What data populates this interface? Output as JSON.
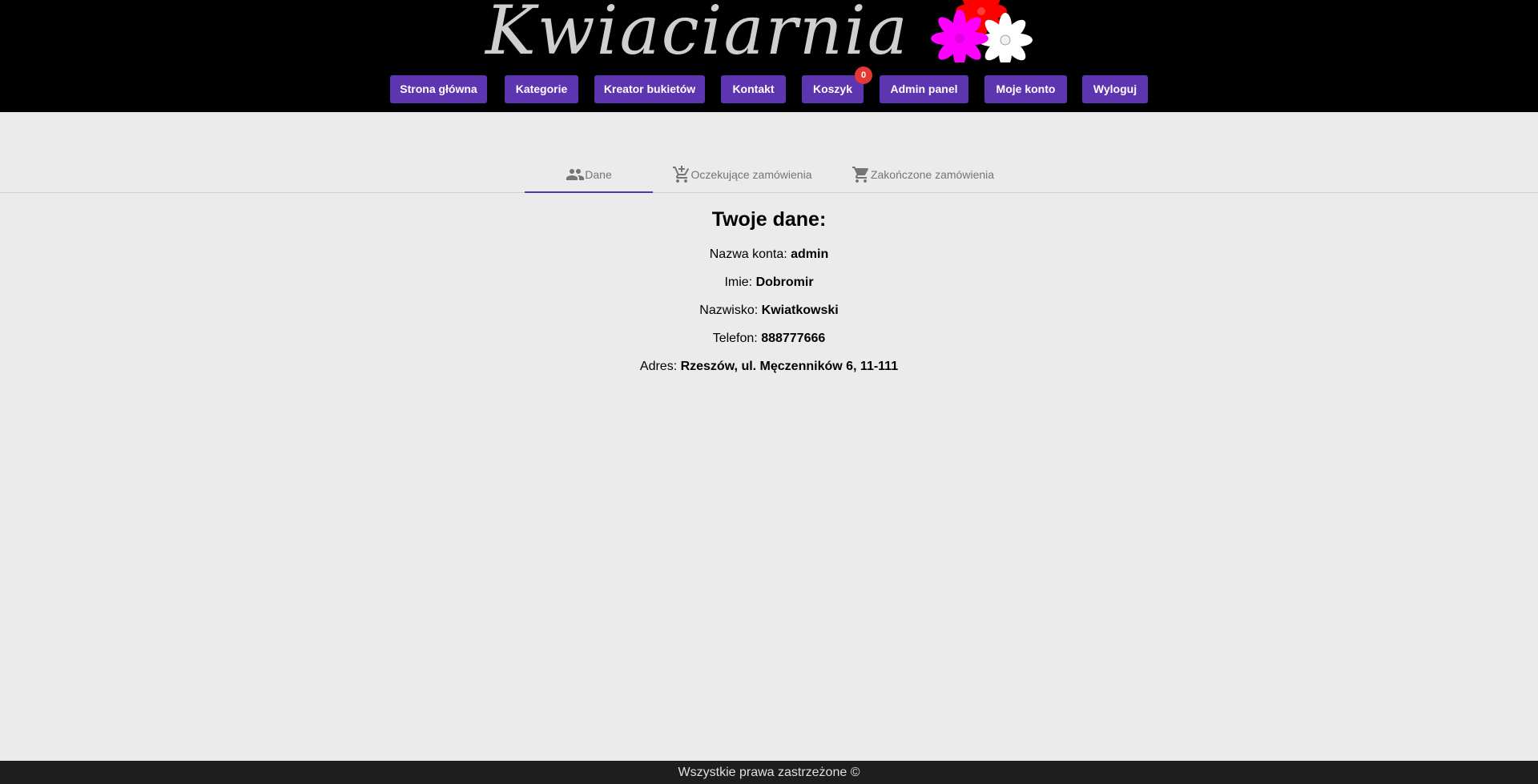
{
  "header": {
    "brand": "Kwiaciarnia",
    "colors": {
      "background": "#000000",
      "brand_text": "#cfcfcf",
      "nav_button": "#5e35b1",
      "badge": "#e53935"
    }
  },
  "nav": {
    "items": [
      {
        "label": "Strona główna"
      },
      {
        "label": "Kategorie"
      },
      {
        "label": "Kreator bukietów"
      },
      {
        "label": "Kontakt"
      },
      {
        "label": "Koszyk",
        "badge": "0"
      },
      {
        "label": "Admin panel"
      },
      {
        "label": "Moje konto"
      },
      {
        "label": "Wyloguj"
      }
    ]
  },
  "tabs": [
    {
      "label": "Dane",
      "icon": "people-icon",
      "active": true
    },
    {
      "label": "Oczekujące zamówienia",
      "icon": "add-shopping-cart-icon",
      "active": false
    },
    {
      "label": "Zakończone zamówienia",
      "icon": "shopping-cart-icon",
      "active": false
    }
  ],
  "profile": {
    "title": "Twoje dane:",
    "fields": [
      {
        "label": "Nazwa konta:",
        "value": "admin"
      },
      {
        "label": "Imie:",
        "value": "Dobromir"
      },
      {
        "label": "Nazwisko:",
        "value": "Kwiatkowski"
      },
      {
        "label": "Telefon:",
        "value": "888777666"
      },
      {
        "label": "Adres:",
        "value": "Rzeszów, ul. Męczenników 6, 11-111"
      }
    ]
  },
  "footer": {
    "text": "Wszystkie prawa zastrzeżone ©"
  }
}
